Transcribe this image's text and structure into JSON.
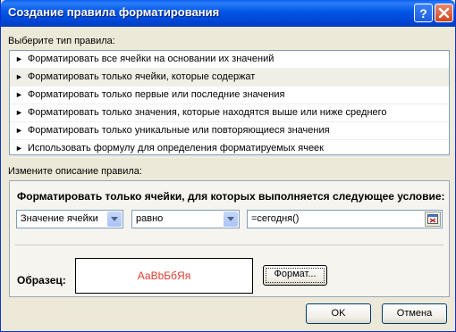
{
  "window": {
    "title": "Создание правила форматирования",
    "help_symbol": "?",
    "close_symbol": "×"
  },
  "rule_type": {
    "label": "Выберите тип правила:",
    "items": [
      "Форматировать все ячейки на основании их значений",
      "Форматировать только ячейки, которые содержат",
      "Форматировать только первые или последние значения",
      "Форматировать только значения, которые находятся выше или ниже среднего",
      "Форматировать только уникальные или повторяющиеся значения",
      "Использовать формулу для определения форматируемых ячеек"
    ],
    "selected_index": 1,
    "bullet": "►"
  },
  "description": {
    "label": "Измените описание правила:",
    "condition_title": "Форматировать только ячейки, для которых выполняется следующее условие:",
    "condition_type": "Значение ячейки",
    "operator": "равно",
    "formula": "=сегодня()"
  },
  "preview": {
    "label": "Образец:",
    "sample_text": "АаВbБбЯя",
    "sample_color": "#e03a2e",
    "format_button": "Формат..."
  },
  "buttons": {
    "ok": "OK",
    "cancel": "Отмена"
  }
}
